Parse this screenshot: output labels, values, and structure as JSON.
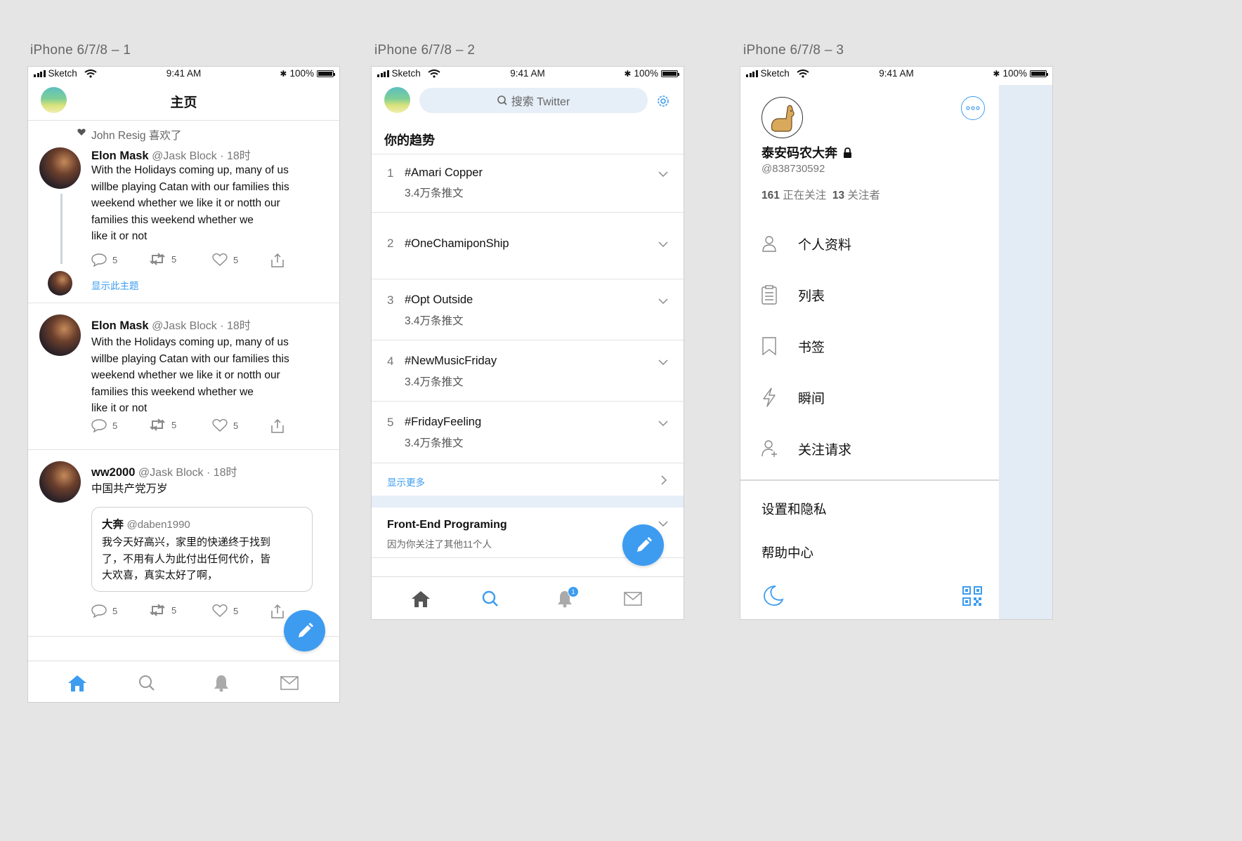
{
  "artboards": [
    {
      "label": "iPhone 6/7/8 – 1"
    },
    {
      "label": "iPhone 6/7/8 – 2"
    },
    {
      "label": "iPhone 6/7/8 – 3"
    }
  ],
  "statusbar": {
    "carrier": "Sketch",
    "time": "9:41 AM",
    "battery": "100%"
  },
  "home": {
    "title": "主页",
    "liked_by": "John Resig 喜欢了",
    "show_thread": "显示此主题",
    "tweets": [
      {
        "name": "Elon Mask",
        "meta": "@Jask Block · 18时",
        "lines": [
          "With the Holidays coming up, many of us",
          "willbe playing Catan with our families this",
          "weekend whether we like it or notth our",
          "families this  weekend whether we",
          "like it or not"
        ],
        "counts": {
          "reply": "5",
          "retweet": "5",
          "like": "5"
        }
      },
      {
        "name": "Elon Mask",
        "meta": "@Jask Block · 18时",
        "lines": [
          "With the Holidays coming up, many of us",
          "willbe playing Catan with our families this",
          "weekend whether we like it or notth our",
          "families this  weekend whether we",
          "like it or not"
        ],
        "counts": {
          "reply": "5",
          "retweet": "5",
          "like": "5"
        }
      },
      {
        "name": "ww2000",
        "meta": "@Jask Block · 18时",
        "text": "中国共产党万岁",
        "quote": {
          "name": "大奔",
          "handle": "@daben1990",
          "lines": [
            "我今天好高兴，家里的快递终于找到",
            "了，不用有人为此付出任何代价，皆",
            "大欢喜，真实太好了啊，"
          ]
        },
        "counts": {
          "reply": "5",
          "retweet": "5",
          "like": "5"
        }
      }
    ]
  },
  "explore": {
    "search_placeholder": "搜索 Twitter",
    "section_title": "你的趋势",
    "trends": [
      {
        "rank": "1",
        "tag": "#Amari Copper",
        "count": "3.4万条推文"
      },
      {
        "rank": "2",
        "tag": "#OneChamiponShip",
        "count": ""
      },
      {
        "rank": "3",
        "tag": "#Opt Outside",
        "count": "3.4万条推文"
      },
      {
        "rank": "4",
        "tag": "#NewMusicFriday",
        "count": "3.4万条推文"
      },
      {
        "rank": "5",
        "tag": "#FridayFeeling",
        "count": "3.4万条推文"
      }
    ],
    "show_more": "显示更多",
    "topic": {
      "title": "Front-End Programing",
      "subtitle": "因为你关注了其他11个人"
    },
    "notification_badge": "1"
  },
  "drawer": {
    "name": "泰安码农大奔",
    "handle": "@838730592",
    "following_count": "161",
    "following_label": "正在关注",
    "followers_count": "13",
    "followers_label": "关注者",
    "menu": [
      {
        "label": "个人资料",
        "icon": "person-icon"
      },
      {
        "label": "列表",
        "icon": "list-icon"
      },
      {
        "label": "书签",
        "icon": "bookmark-icon"
      },
      {
        "label": "瞬间",
        "icon": "lightning-icon"
      },
      {
        "label": "关注请求",
        "icon": "follow-request-icon"
      }
    ],
    "settings": "设置和隐私",
    "help": "帮助中心"
  },
  "colors": {
    "accent": "#3d9cf0",
    "link": "#3d9cf0",
    "search_bg": "#e6eef7",
    "drawer_overlay": "#e3ebf5"
  }
}
